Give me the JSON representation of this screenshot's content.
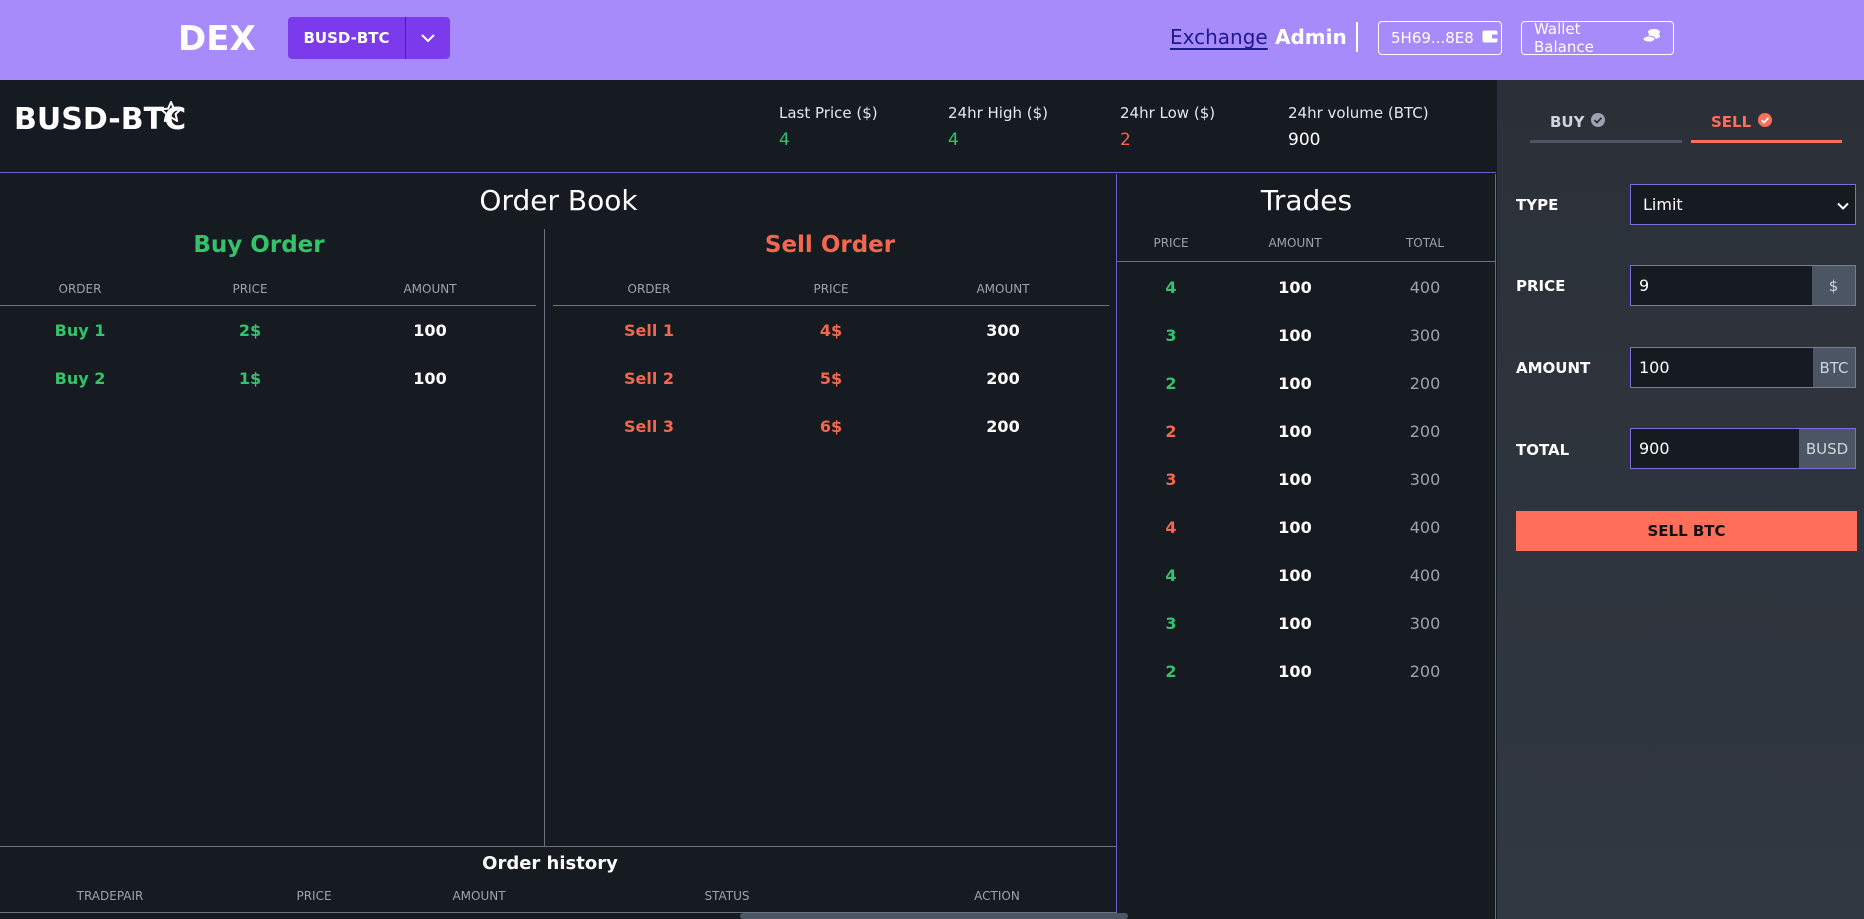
{
  "navbar": {
    "logo": "DEX",
    "pair_selector": "BUSD-BTC",
    "links": {
      "exchange": "Exchange",
      "admin": "Admin"
    },
    "wallet_address": "5H69...8E8",
    "wallet_balance": "Wallet Balance"
  },
  "ticker": {
    "pair": "BUSD-BTC",
    "stats": [
      {
        "label": "Last Price ($)",
        "value": "4"
      },
      {
        "label": "24hr High ($)",
        "value": "4"
      },
      {
        "label": "24hr Low ($)",
        "value": "2"
      },
      {
        "label": "24hr volume (BTC)",
        "value": "900"
      }
    ]
  },
  "orderbook": {
    "title": "Order Book",
    "columns": [
      "ORDER",
      "PRICE",
      "AMOUNT"
    ],
    "buy": {
      "title": "Buy Order",
      "rows": [
        {
          "order": "Buy 1",
          "price": "2$",
          "amount": "100"
        },
        {
          "order": "Buy 2",
          "price": "1$",
          "amount": "100"
        }
      ]
    },
    "sell": {
      "title": "Sell Order",
      "rows": [
        {
          "order": "Sell 1",
          "price": "4$",
          "amount": "300"
        },
        {
          "order": "Sell 2",
          "price": "5$",
          "amount": "200"
        },
        {
          "order": "Sell 3",
          "price": "6$",
          "amount": "200"
        }
      ]
    }
  },
  "history": {
    "title": "Order history",
    "columns": [
      "TRADEPAIR",
      "PRICE",
      "AMOUNT",
      "STATUS",
      "ACTION"
    ]
  },
  "trades": {
    "title": "Trades",
    "columns": [
      "PRICE",
      "AMOUNT",
      "TOTAL"
    ],
    "rows": [
      {
        "price": "4",
        "amount": "100",
        "total": "400",
        "side": "buy"
      },
      {
        "price": "3",
        "amount": "100",
        "total": "300",
        "side": "buy"
      },
      {
        "price": "2",
        "amount": "100",
        "total": "200",
        "side": "buy"
      },
      {
        "price": "2",
        "amount": "100",
        "total": "200",
        "side": "sell"
      },
      {
        "price": "3",
        "amount": "100",
        "total": "300",
        "side": "sell"
      },
      {
        "price": "4",
        "amount": "100",
        "total": "400",
        "side": "sell"
      },
      {
        "price": "4",
        "amount": "100",
        "total": "400",
        "side": "buy"
      },
      {
        "price": "3",
        "amount": "100",
        "total": "300",
        "side": "buy"
      },
      {
        "price": "2",
        "amount": "100",
        "total": "200",
        "side": "buy"
      }
    ]
  },
  "panel": {
    "tabs": {
      "buy": "BUY",
      "sell": "SELL",
      "active": "sell"
    },
    "type": {
      "label": "TYPE",
      "value": "Limit"
    },
    "price": {
      "label": "PRICE",
      "value": "9",
      "unit": "$"
    },
    "amount": {
      "label": "AMOUNT",
      "value": "100",
      "unit": "BTC"
    },
    "total": {
      "label": "TOTAL",
      "value": "900",
      "unit": "BUSD"
    },
    "submit": "SELL BTC"
  },
  "colors": {
    "navbar": "#a78bfa",
    "accent": "#7c3aed",
    "buy": "#34c26b",
    "sell": "#f2674f",
    "sell_button": "#fe6e58",
    "background": "#161a21"
  }
}
